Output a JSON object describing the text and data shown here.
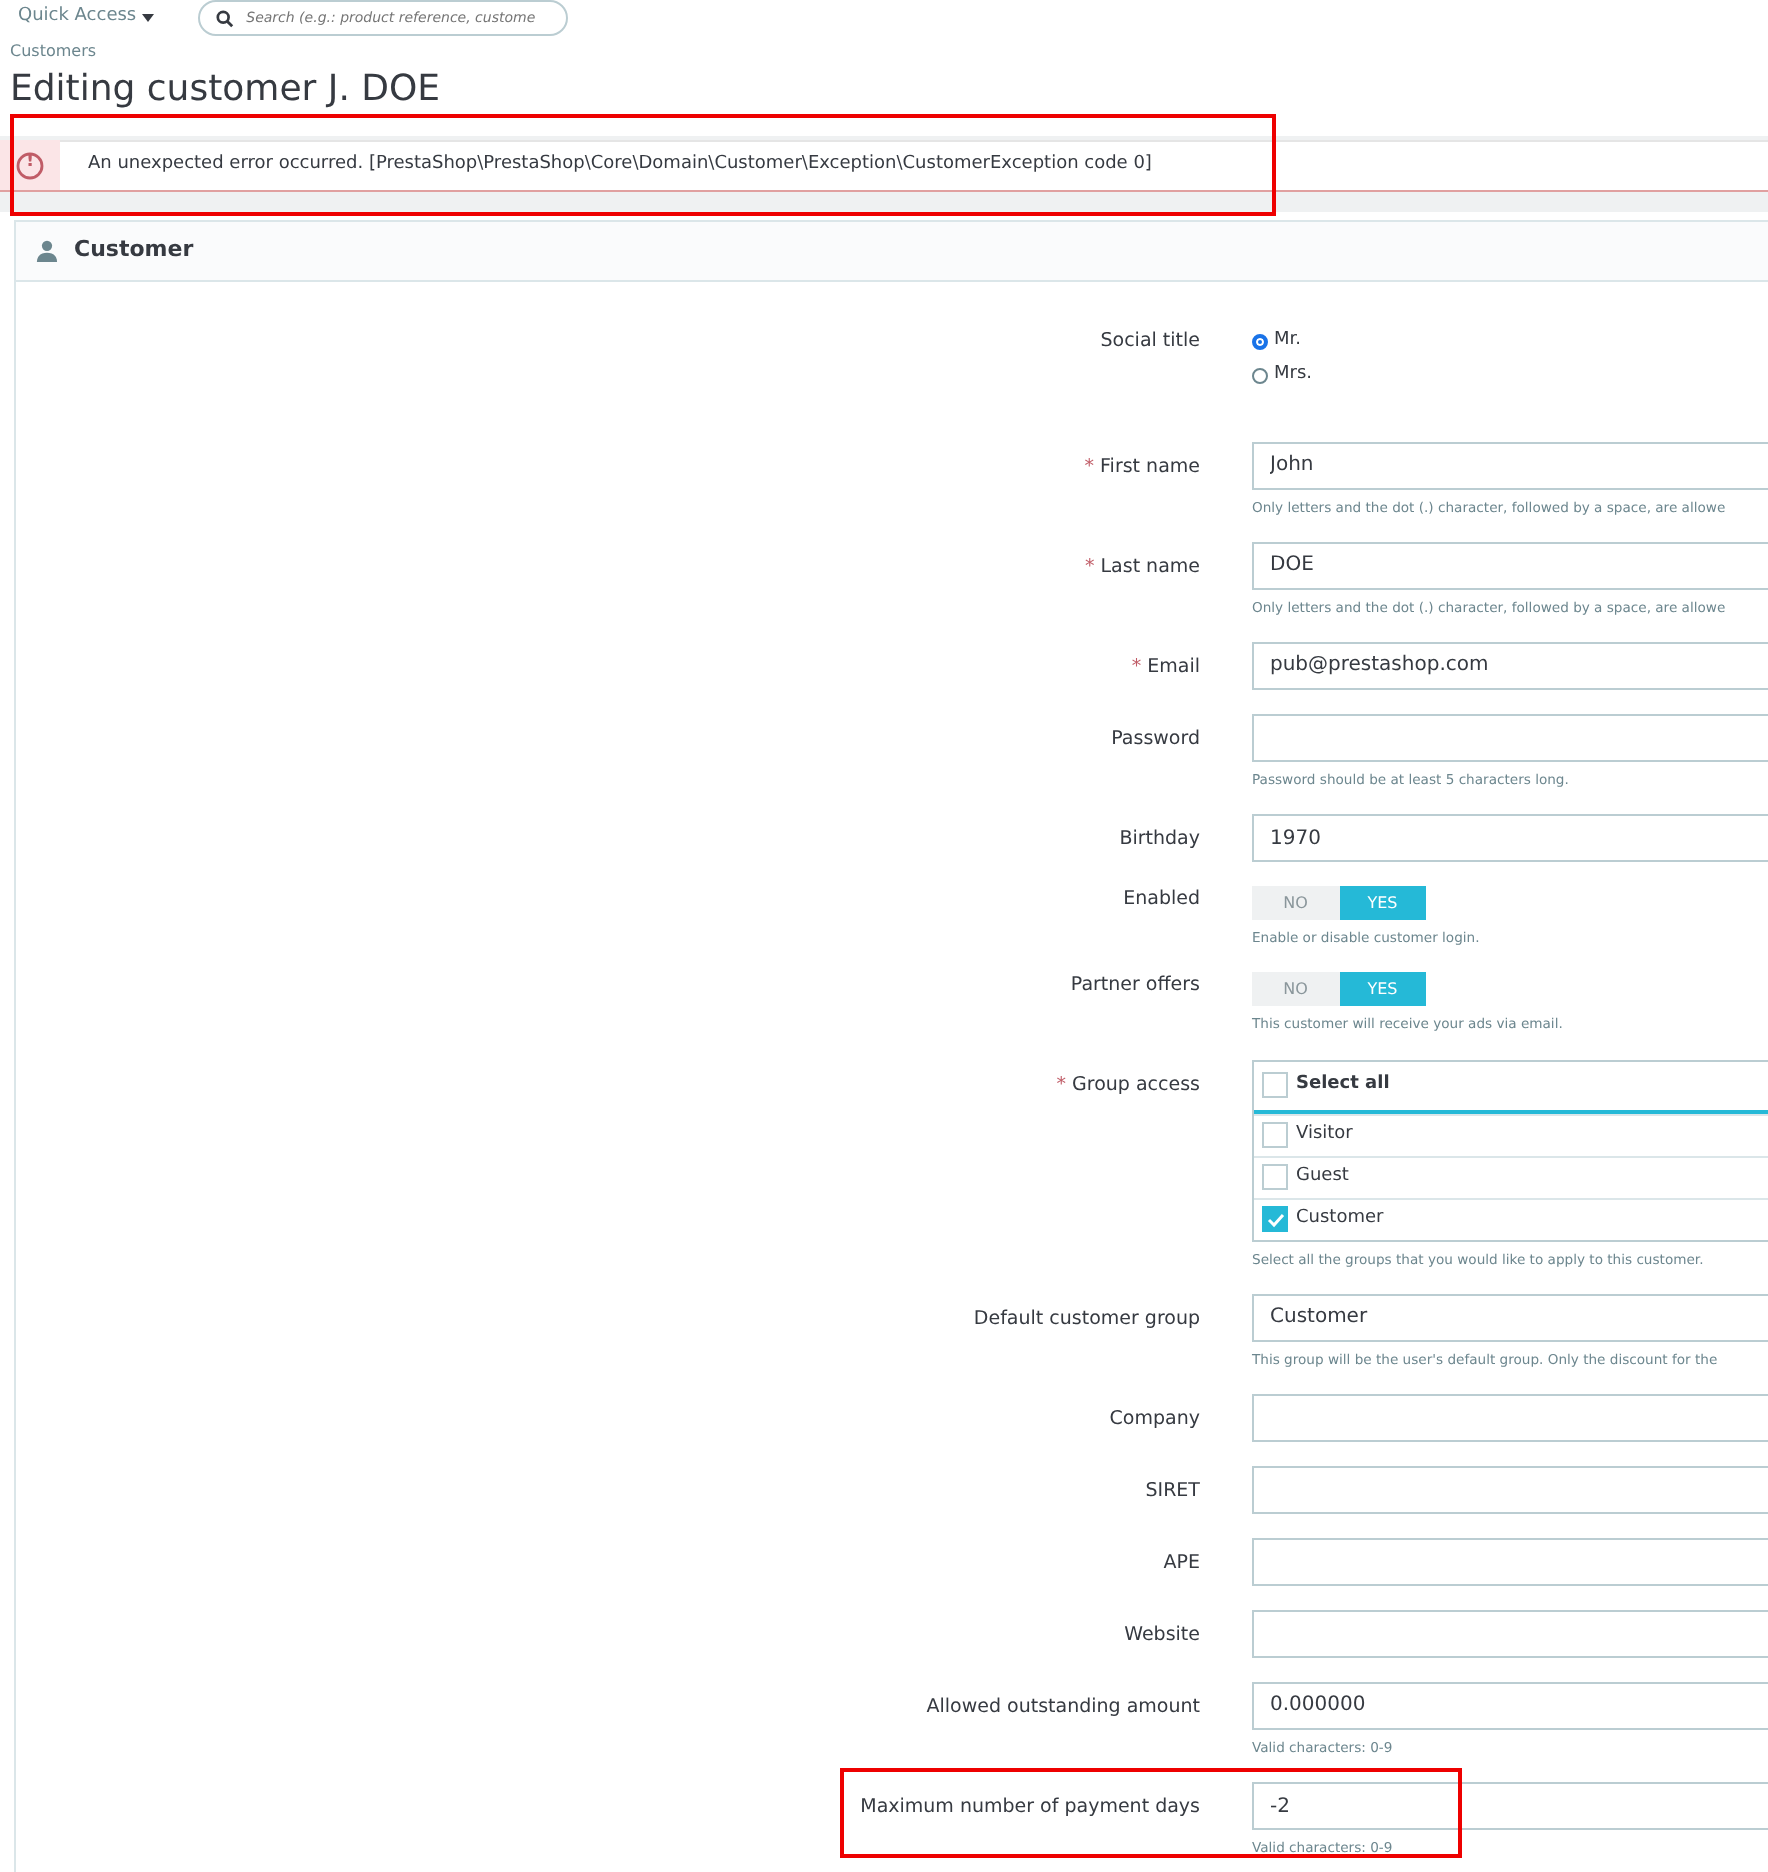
{
  "header": {
    "quick_access": "Quick Access",
    "search": {
      "placeholder": "Search (e.g.: product reference, custome"
    }
  },
  "breadcrumb": "Customers",
  "title": "Editing customer J. DOE",
  "error": {
    "icon": "!",
    "message": "An unexpected error occurred. [PrestaShop\\PrestaShop\\Core\\Domain\\Customer\\Exception\\CustomerException code 0]",
    "highlighted": true
  },
  "panel": {
    "title": "Customer"
  },
  "fields": [
    {
      "kind": "radio",
      "label": "Social title",
      "options": [
        {
          "label": "Mr.",
          "selected": true
        },
        {
          "label": "Mrs.",
          "selected": false
        }
      ]
    },
    {
      "kind": "text",
      "label": "First name",
      "required_mark": "*",
      "value": "John",
      "help": "Only letters and the dot (.) character, followed by a space, are allowe"
    },
    {
      "kind": "text",
      "label": "Last name",
      "required_mark": "*",
      "value": "DOE",
      "help": "Only letters and the dot (.) character, followed by a space, are allowe"
    },
    {
      "kind": "text",
      "label": "Email",
      "required_mark": "*",
      "value": "pub@prestashop.com"
    },
    {
      "kind": "text",
      "label": "Password",
      "help": "Password should be at least 5 characters long."
    },
    {
      "kind": "text",
      "label": "Birthday",
      "value": "1970"
    },
    {
      "kind": "switch",
      "label": "Enabled",
      "no": "NO",
      "yes": "YES",
      "on": true,
      "help": "Enable or disable customer login."
    },
    {
      "kind": "switch",
      "label": "Partner offers",
      "no": "NO",
      "yes": "YES",
      "on": true,
      "help": "This customer will receive your ads via email."
    },
    {
      "kind": "checklist",
      "label": "Group access",
      "required_mark": "*",
      "select_all": {
        "label": "Select all",
        "checked": false
      },
      "items": [
        {
          "label": "Visitor",
          "checked": false
        },
        {
          "label": "Guest",
          "checked": false
        },
        {
          "label": "Customer",
          "checked": true
        }
      ],
      "help": "Select all the groups that you would like to apply to this customer."
    },
    {
      "kind": "text",
      "label": "Default customer group",
      "value": "Customer",
      "help": "This group will be the user's default group. Only the discount for the"
    },
    {
      "kind": "text",
      "label": "Company"
    },
    {
      "kind": "text",
      "label": "SIRET"
    },
    {
      "kind": "text",
      "label": "APE"
    },
    {
      "kind": "text",
      "label": "Website"
    },
    {
      "kind": "text",
      "label": "Allowed outstanding amount",
      "value": "0.000000",
      "help": "Valid characters: 0-9"
    },
    {
      "kind": "text",
      "label": "Maximum number of payment days",
      "value": "-2",
      "help": "Valid characters: 0-9",
      "highlighted": true
    }
  ]
}
